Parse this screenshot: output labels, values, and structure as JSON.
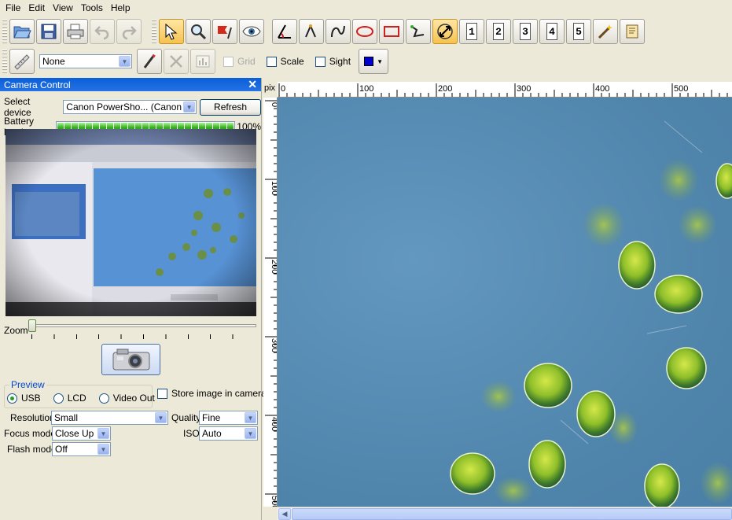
{
  "menu": [
    "File",
    "Edit",
    "View",
    "Tools",
    "Help"
  ],
  "toolbar": {
    "numbered_tools": [
      "1",
      "2",
      "3",
      "4",
      "5"
    ],
    "line_style": "None",
    "grid_label": "Grid",
    "scale_label": "Scale",
    "sight_label": "Sight",
    "color_swatch": "#0000cc"
  },
  "camera_panel": {
    "title": "Camera Control",
    "select_device_label": "Select device",
    "device_value": "Canon PowerSho... (Canon PS",
    "refresh_label": "Refresh",
    "battery_label": "Battery level",
    "battery_value": "100%",
    "battery_level": 1.0,
    "zoom_label": "Zoom",
    "zoom_level": 0.0,
    "preview_group_label": "Preview",
    "preview_options": [
      "USB",
      "LCD",
      "Video Out"
    ],
    "preview_selected": "USB",
    "store_label": "Store image in camera",
    "resolution_label": "Resolution",
    "resolution_value": "Small",
    "quality_label": "Quality",
    "quality_value": "Fine",
    "focus_label": "Focus mode",
    "focus_value": "Close Up",
    "iso_label": "ISO",
    "iso_value": "Auto",
    "flash_label": "Flash mode",
    "flash_value": "Off"
  },
  "ruler": {
    "unit": "pix",
    "h_labels": [
      "0",
      "100",
      "200",
      "300",
      "400",
      "500"
    ],
    "v_labels": [
      "0",
      "100",
      "200",
      "300",
      "400",
      "500"
    ]
  },
  "colors": {
    "title_bar": "#0a5fd7",
    "canvas_bg": "#5a8db5",
    "cell_green": "#8fbf2a"
  }
}
